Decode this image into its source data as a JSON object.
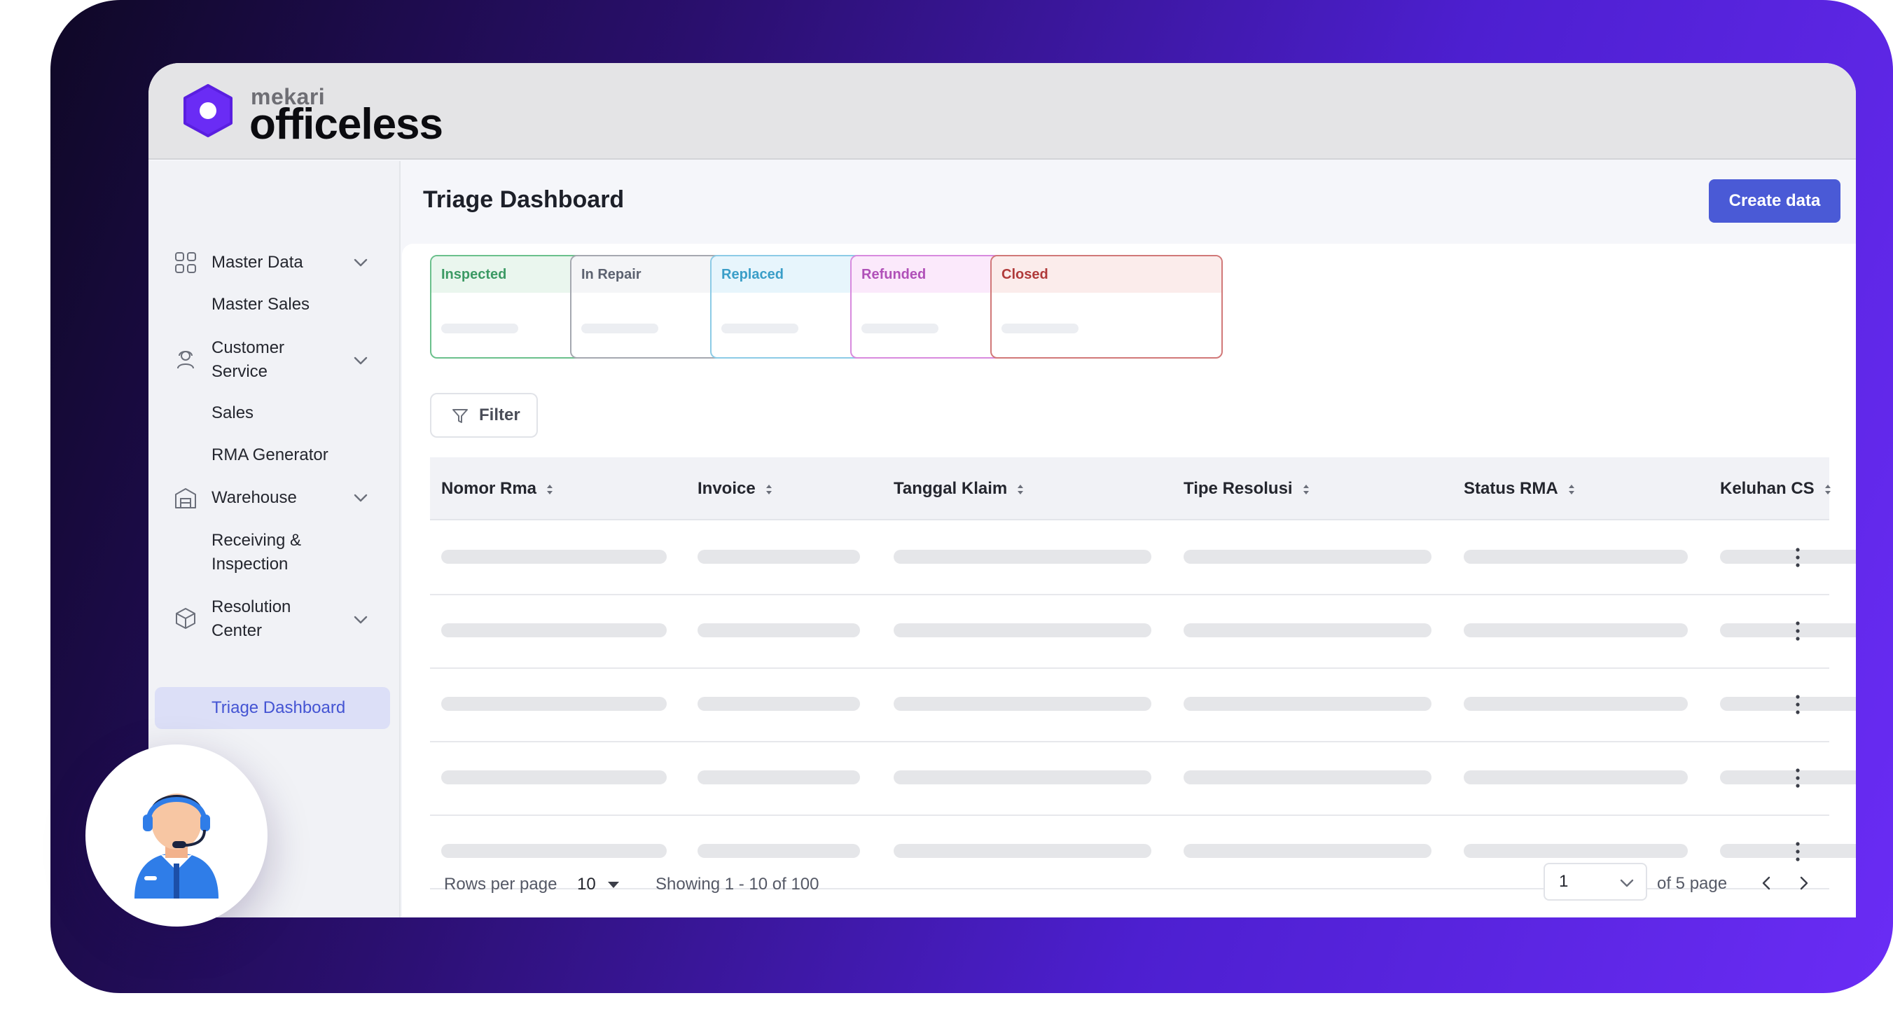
{
  "brand": {
    "small": "mekari",
    "name": "officeless"
  },
  "header": {
    "title": "Triage Dashboard",
    "create_label": "Create data"
  },
  "sidebar": {
    "items": [
      {
        "label": "Master Data",
        "icon": "grid-icon"
      },
      {
        "label": "Master Sales"
      },
      {
        "label": "Customer Service",
        "icon": "user-headset-icon"
      },
      {
        "label": "Sales"
      },
      {
        "label": "RMA Generator"
      },
      {
        "label": "Warehouse",
        "icon": "warehouse-icon"
      },
      {
        "label": "Receiving & Inspection"
      },
      {
        "label": "Resolution Center",
        "icon": "box-icon"
      },
      {
        "label": "Triage Dashboard",
        "active": true
      }
    ]
  },
  "status_cards": [
    {
      "label": "Inspected",
      "color": "#3c9a64",
      "bg": "#eaf6ee",
      "border": "#6bc08c"
    },
    {
      "label": "In Repair",
      "color": "#5c6270",
      "bg": "#f4f5f7",
      "border": "#a5a8b0"
    },
    {
      "label": "Replaced",
      "color": "#3a9ec8",
      "bg": "#e7f5fc",
      "border": "#8ccbe6"
    },
    {
      "label": "Refunded",
      "color": "#b050b8",
      "bg": "#fbe9fb",
      "border": "#d88ade"
    },
    {
      "label": "Closed",
      "color": "#b03a3a",
      "bg": "#fbeceb",
      "border": "#d17878"
    }
  ],
  "filter": {
    "label": "Filter"
  },
  "table": {
    "columns": [
      "Nomor Rma",
      "Invoice",
      "Tanggal Klaim",
      "Tipe Resolusi",
      "Status RMA",
      "Keluhan CS"
    ],
    "row_count": 5
  },
  "pagination": {
    "rows_per_page_label": "Rows per page",
    "rows_per_page_value": "10",
    "showing": "Showing 1 - 10 of 100",
    "current_page": "1",
    "of_pages": "of 5 page"
  },
  "colors": {
    "accent": "#4a5ad6",
    "active_bg": "#dcdff7",
    "gradient_start": "#0f0826",
    "gradient_end": "#6a2cf5"
  }
}
